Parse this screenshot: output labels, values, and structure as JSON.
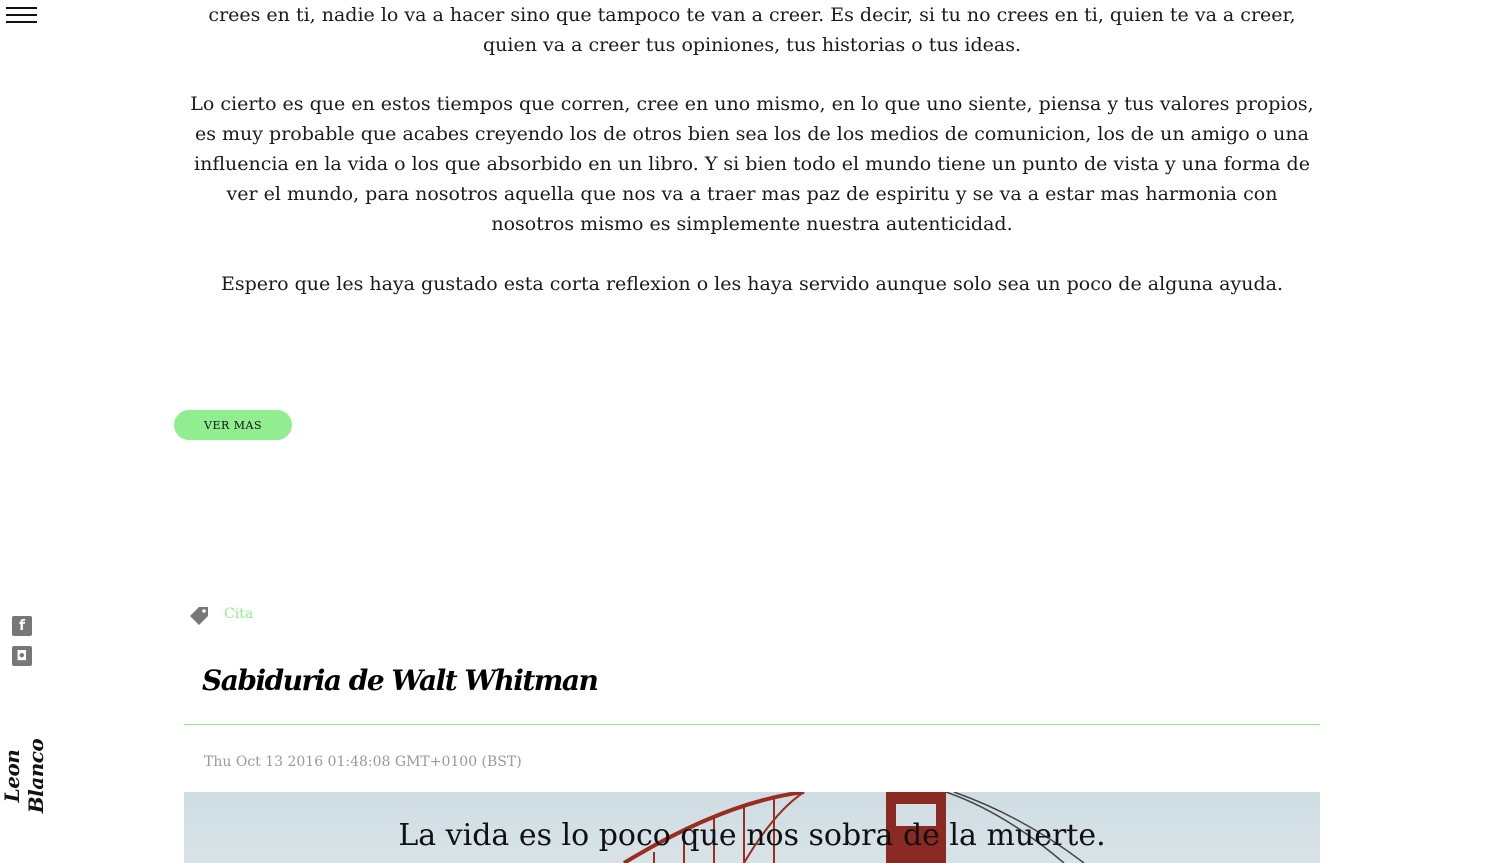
{
  "article": {
    "para1": "crees en ti, nadie lo va a hacer sino que tampoco te van a creer. Es decir, si tu no crees en ti, quien te va a creer, quien va a creer tus opiniones, tus historias o tus ideas.",
    "para2": "Lo cierto es que en estos tiempos que corren, cree en uno mismo, en lo que uno siente, piensa y tus valores propios, es muy probable que acabes creyendo los de otros bien sea los de los medios de comunicion, los de un amigo o una influencia en la vida o los que absorbido en un libro. Y si bien todo el mundo tiene un punto de vista y una forma de ver el mundo, para nosotros aquella que nos va a traer mas paz de espiritu y se va a estar mas harmonia con nosotros mismo es simplemente nuestra autenticidad.",
    "para3": "Espero que les haya gustado esta corta reflexion o les haya servido aunque solo sea un poco de alguna ayuda.",
    "more_label": "VER MAS"
  },
  "next_post": {
    "tag": "Cita",
    "title": "Sabiduria de Walt Whitman",
    "date": "Thu Oct 13 2016 01:48:08 GMT+0100 (BST)",
    "hero_quote": "La vida es lo poco que nos sobra de la muerte."
  },
  "sidebar": {
    "brand": "Leon Blanco",
    "social": [
      {
        "icon": "facebook-icon",
        "glyph": "f"
      },
      {
        "icon": "instagram-icon",
        "glyph": "◘"
      }
    ]
  },
  "colors": {
    "accent": "#90ee90",
    "text": "#111111",
    "muted": "#999999"
  }
}
